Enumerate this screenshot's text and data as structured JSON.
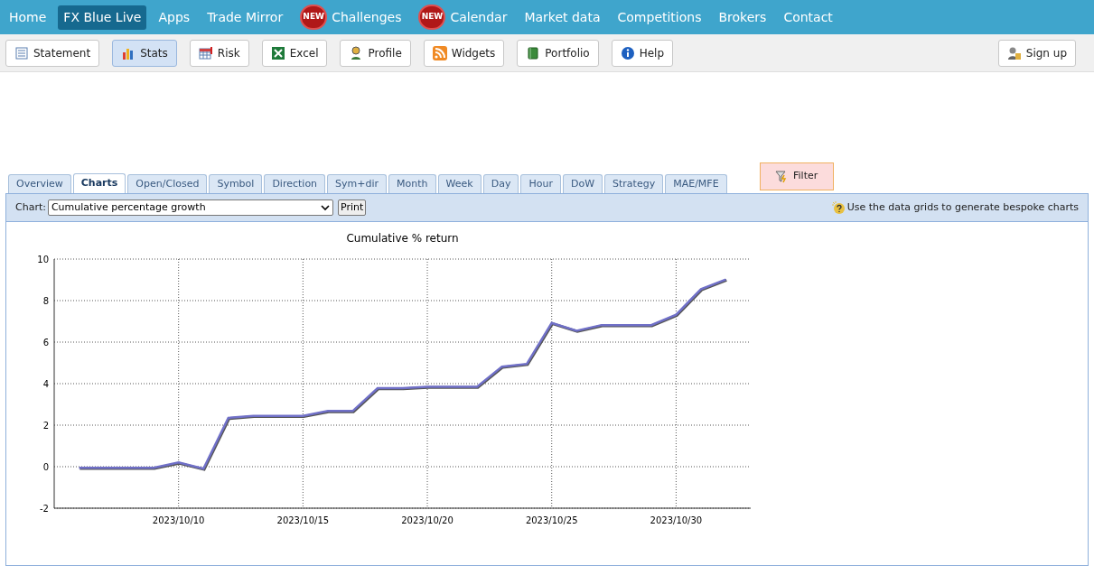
{
  "nav": [
    {
      "label": "Home",
      "selected": false
    },
    {
      "label": "FX Blue Live",
      "selected": true
    },
    {
      "label": "Apps",
      "selected": false
    },
    {
      "label": "Trade Mirror",
      "selected": false
    },
    {
      "label": "Challenges",
      "selected": false,
      "badge": "NEW"
    },
    {
      "label": "Calendar",
      "selected": false,
      "badge": "NEW"
    },
    {
      "label": "Market data",
      "selected": false
    },
    {
      "label": "Competitions",
      "selected": false
    },
    {
      "label": "Brokers",
      "selected": false
    },
    {
      "label": "Contact",
      "selected": false
    }
  ],
  "toolbar": [
    {
      "label": "Statement",
      "kind": "statement",
      "selected": false
    },
    {
      "label": "Stats",
      "kind": "stats",
      "selected": true
    },
    {
      "label": "Risk",
      "kind": "risk",
      "selected": false
    },
    {
      "label": "Excel",
      "kind": "excel",
      "selected": false
    },
    {
      "label": "Profile",
      "kind": "profile",
      "selected": false
    },
    {
      "label": "Widgets",
      "kind": "widgets",
      "selected": false
    },
    {
      "label": "Portfolio",
      "kind": "portfolio",
      "selected": false
    },
    {
      "label": "Help",
      "kind": "help",
      "selected": false
    }
  ],
  "signup": {
    "label": "Sign up"
  },
  "tabs": [
    {
      "label": "Overview",
      "selected": false
    },
    {
      "label": "Charts",
      "selected": true
    },
    {
      "label": "Open/Closed",
      "selected": false
    },
    {
      "label": "Symbol",
      "selected": false
    },
    {
      "label": "Direction",
      "selected": false
    },
    {
      "label": "Sym+dir",
      "selected": false
    },
    {
      "label": "Month",
      "selected": false
    },
    {
      "label": "Week",
      "selected": false
    },
    {
      "label": "Day",
      "selected": false
    },
    {
      "label": "Hour",
      "selected": false
    },
    {
      "label": "DoW",
      "selected": false
    },
    {
      "label": "Strategy",
      "selected": false
    },
    {
      "label": "MAE/MFE",
      "selected": false
    }
  ],
  "filter": {
    "label": "Filter"
  },
  "chart_bar": {
    "label": "Chart:",
    "value": "Cumulative percentage growth",
    "print": "Print",
    "hint": "Use the data grids to generate bespoke charts"
  },
  "chart": {
    "chart_data": {
      "type": "line",
      "title": "Cumulative % return",
      "categories": [
        null,
        null,
        null,
        null,
        "2023/10/10",
        null,
        null,
        null,
        null,
        "2023/10/15",
        null,
        null,
        null,
        null,
        "2023/10/20",
        null,
        null,
        null,
        null,
        "2023/10/25",
        null,
        null,
        null,
        null,
        "2023/10/30",
        null,
        null
      ],
      "series": [
        {
          "color": "#7070c8",
          "values": [
            -0.05,
            -0.05,
            -0.05,
            -0.05,
            0.2,
            -0.1,
            2.35,
            2.45,
            2.45,
            2.45,
            2.68,
            2.68,
            3.78,
            3.78,
            3.85,
            3.85,
            3.85,
            4.82,
            4.95,
            6.92,
            6.55,
            6.82,
            6.82,
            6.82,
            7.32,
            8.55,
            9.02
          ]
        }
      ],
      "ylim": [
        -2,
        10
      ],
      "grid": true,
      "yticks": [
        -2,
        0,
        2,
        4,
        6,
        8,
        10
      ]
    }
  }
}
